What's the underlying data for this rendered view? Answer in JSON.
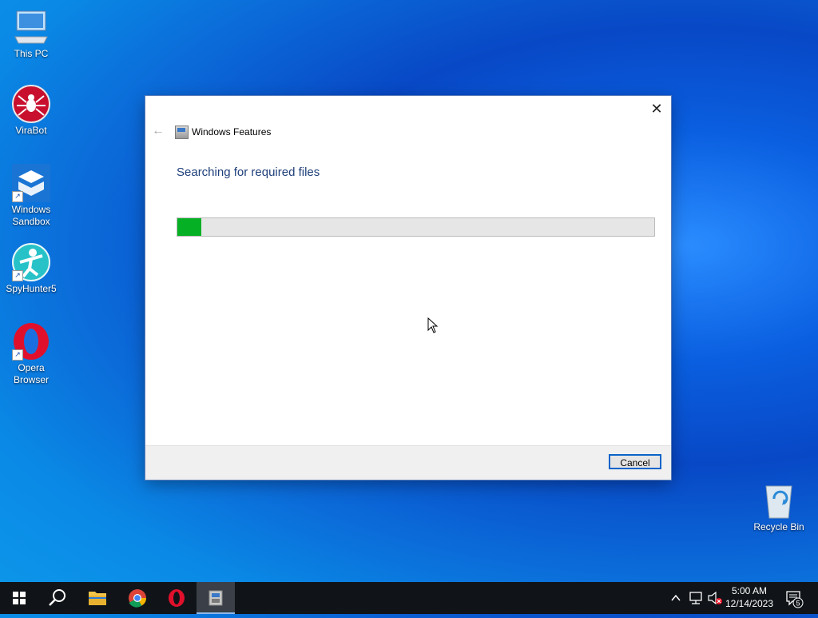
{
  "desktop": {
    "icons": [
      {
        "label": "This PC"
      },
      {
        "label": "ViraBot"
      },
      {
        "label": "Windows Sandbox"
      },
      {
        "label": "SpyHunter5"
      },
      {
        "label": "Opera Browser"
      },
      {
        "label": "Recycle Bin"
      }
    ]
  },
  "dialog": {
    "title": "Windows Features",
    "heading": "Searching for required files",
    "progress": 0.05,
    "cancel_label": "Cancel",
    "close_glyph": "✕",
    "back_glyph": "←"
  },
  "taskbar": {
    "time": "5:00 AM",
    "date": "12/14/2023",
    "notification_count": "5",
    "accent": "#06b025"
  }
}
